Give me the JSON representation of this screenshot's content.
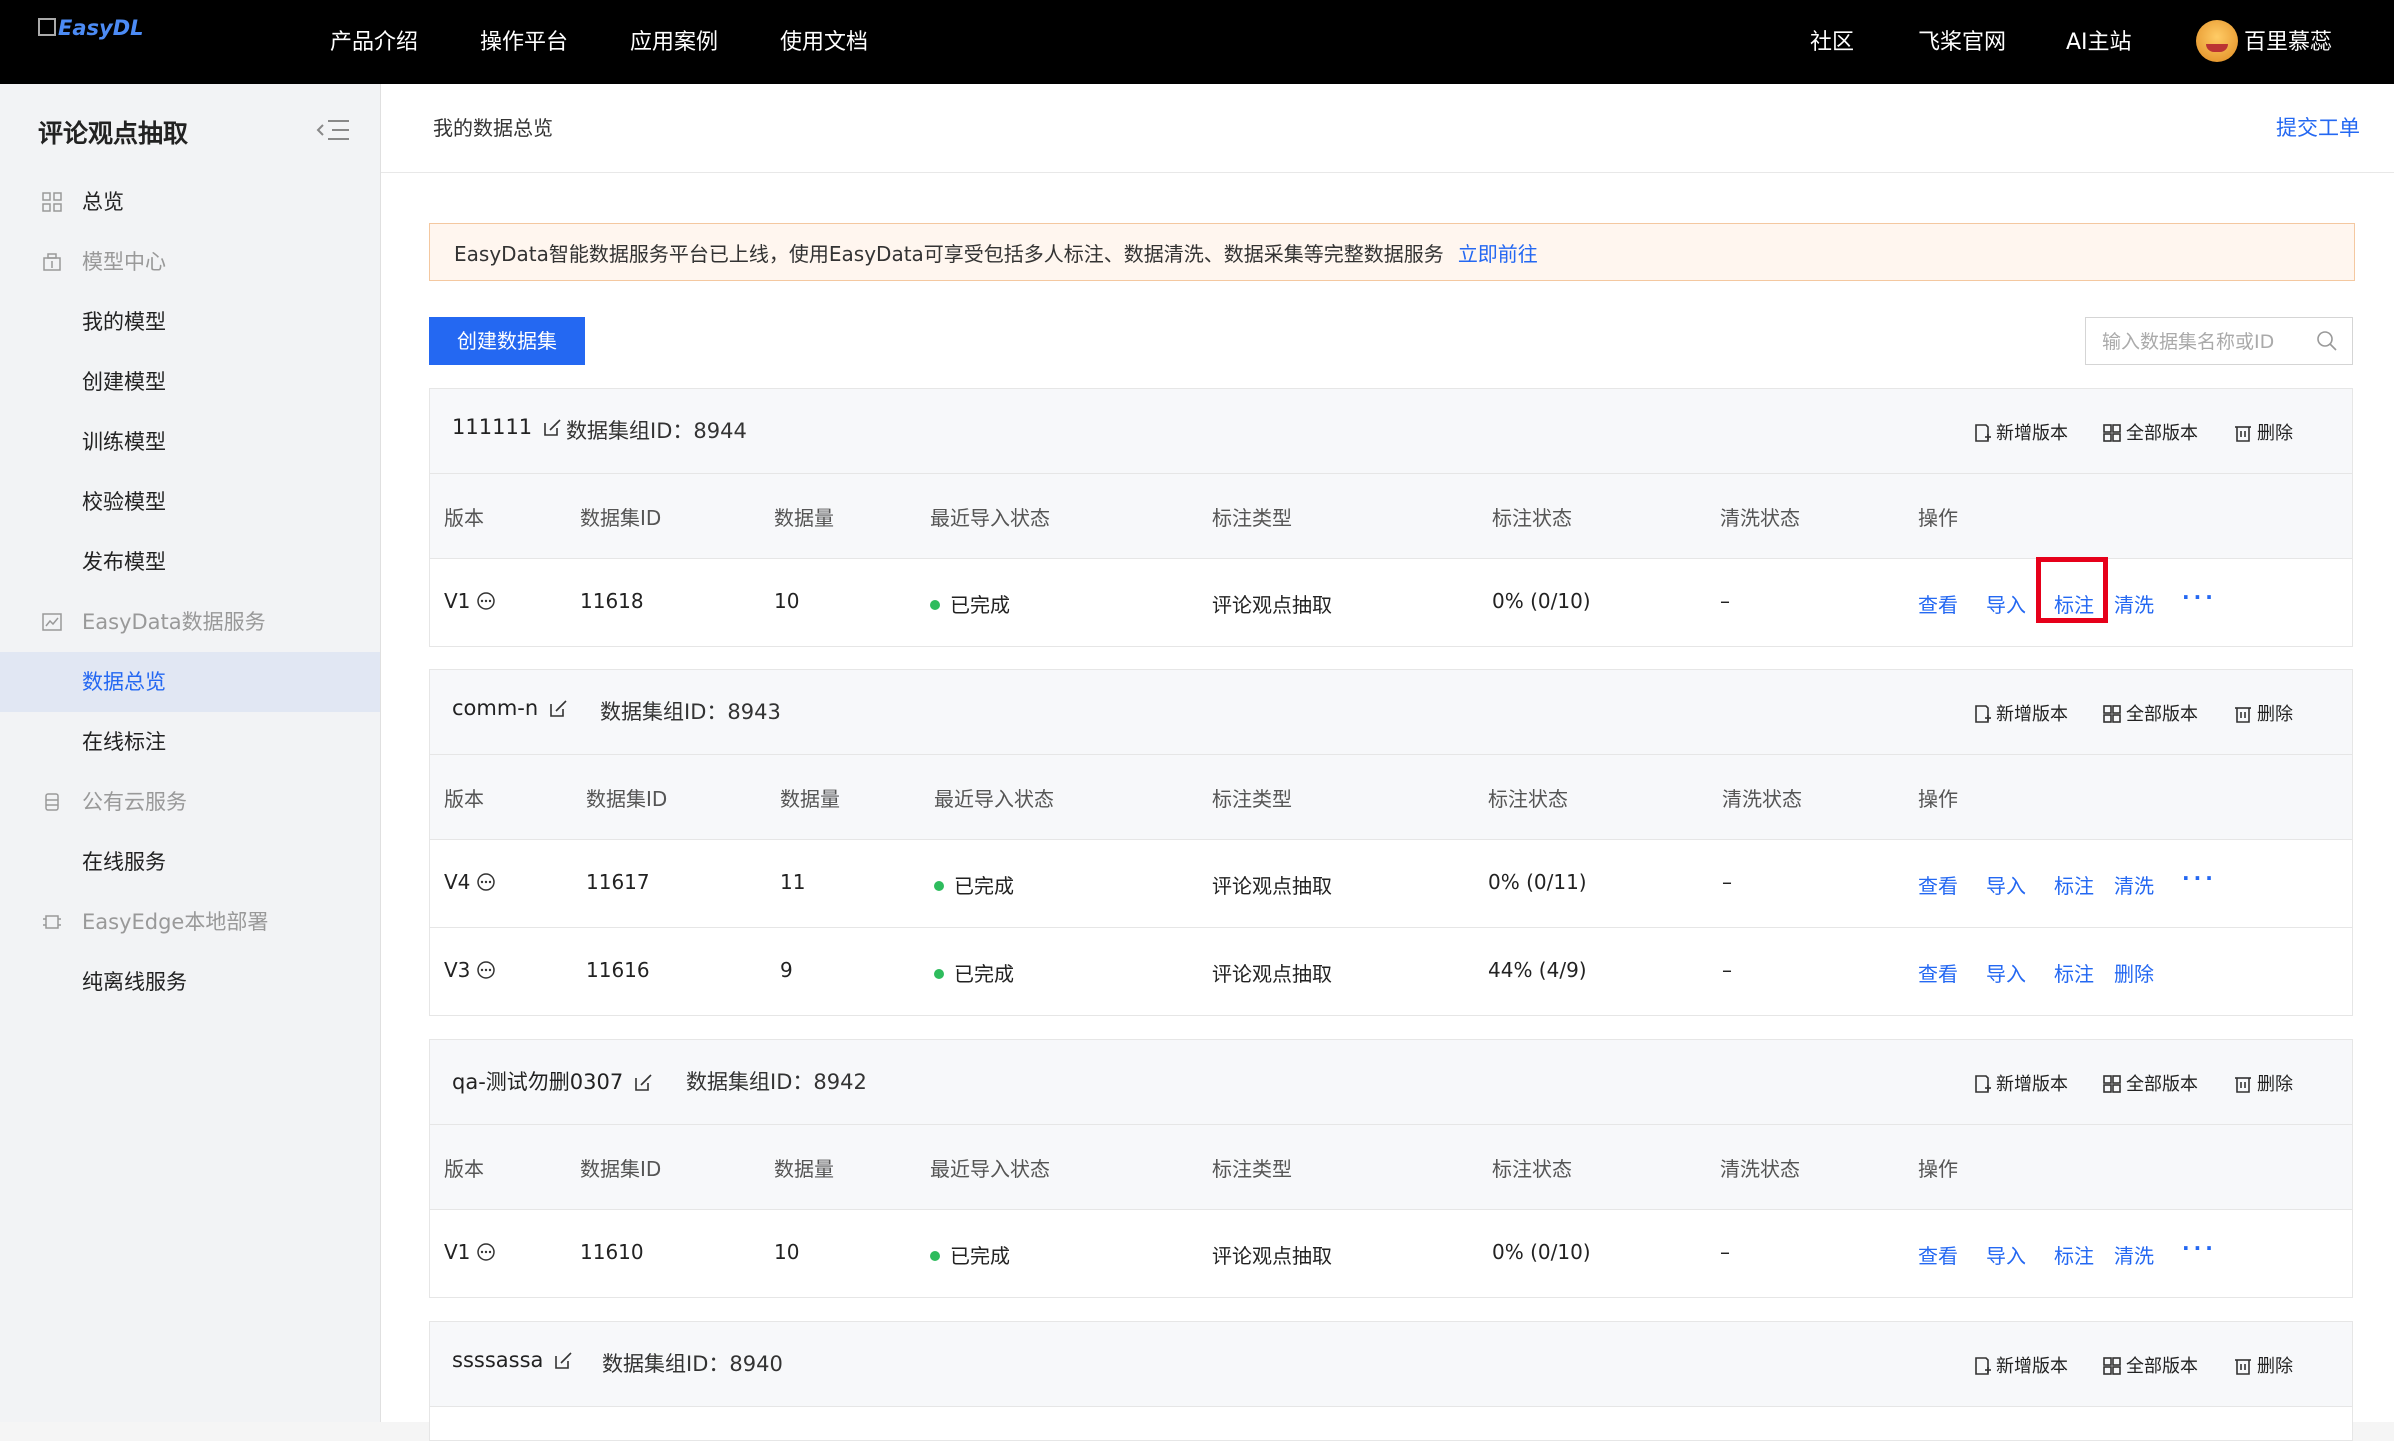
{
  "topbar": {
    "logo": "EasyDL",
    "nav": [
      "产品介绍",
      "操作平台",
      "应用案例",
      "使用文档"
    ],
    "right": [
      "社区",
      "飞桨官网",
      "AI主站"
    ],
    "username": "百里慕蕊"
  },
  "sidebar": {
    "title": "评论观点抽取",
    "items": [
      {
        "label": "总览",
        "icon": "grid-icon"
      },
      {
        "label": "模型中心",
        "icon": "model-icon"
      },
      {
        "label": "我的模型"
      },
      {
        "label": "创建模型"
      },
      {
        "label": "训练模型"
      },
      {
        "label": "校验模型"
      },
      {
        "label": "发布模型"
      },
      {
        "label": "EasyData数据服务",
        "icon": "chart-icon"
      },
      {
        "label": "数据总览"
      },
      {
        "label": "在线标注"
      },
      {
        "label": "公有云服务",
        "icon": "database-icon"
      },
      {
        "label": "在线服务"
      },
      {
        "label": "EasyEdge本地部署",
        "icon": "edge-icon"
      },
      {
        "label": "纯离线服务"
      }
    ]
  },
  "header": {
    "breadcrumb": "我的数据总览",
    "ticket": "提交工单"
  },
  "notice": {
    "text": "EasyData智能数据服务平台已上线，使用EasyData可享受包括多人标注、数据清洗、数据采集等完整数据服务",
    "link": "立即前往"
  },
  "create_button": "创建数据集",
  "search": {
    "placeholder": "输入数据集名称或ID"
  },
  "header_actions": [
    "新增版本",
    "全部版本",
    "删除"
  ],
  "columns": [
    "版本",
    "数据集ID",
    "数据量",
    "最近导入状态",
    "标注类型",
    "标注状态",
    "清洗状态",
    "操作"
  ],
  "datasets": [
    {
      "name": "111111",
      "group_id": "数据集组ID：8944",
      "rows": [
        {
          "version": "V1",
          "id": "11618",
          "count": "10",
          "status": "已完成",
          "type": "评论观点抽取",
          "label_status": "0% (0/10)",
          "clean": "–",
          "ops": [
            "查看",
            "导入",
            "标注",
            "清洗",
            "···"
          ]
        }
      ]
    },
    {
      "name": "comm-n",
      "group_id": "数据集组ID：8943",
      "rows": [
        {
          "version": "V4",
          "id": "11617",
          "count": "11",
          "status": "已完成",
          "type": "评论观点抽取",
          "label_status": "0% (0/11)",
          "clean": "–",
          "ops": [
            "查看",
            "导入",
            "标注",
            "清洗",
            "···"
          ]
        },
        {
          "version": "V3",
          "id": "11616",
          "count": "9",
          "status": "已完成",
          "type": "评论观点抽取",
          "label_status": "44% (4/9)",
          "clean": "–",
          "ops": [
            "查看",
            "导入",
            "标注",
            "删除"
          ]
        }
      ]
    },
    {
      "name": "qa-测试勿删0307",
      "group_id": "数据集组ID：8942",
      "rows": [
        {
          "version": "V1",
          "id": "11610",
          "count": "10",
          "status": "已完成",
          "type": "评论观点抽取",
          "label_status": "0% (0/10)",
          "clean": "–",
          "ops": [
            "查看",
            "导入",
            "标注",
            "清洗",
            "···"
          ]
        }
      ]
    },
    {
      "name": "ssssassa",
      "group_id": "数据集组ID：8940",
      "rows": []
    }
  ],
  "colors": {
    "accent": "#2468f2",
    "highlight": "#e6001a",
    "success": "#2ebc5d"
  }
}
